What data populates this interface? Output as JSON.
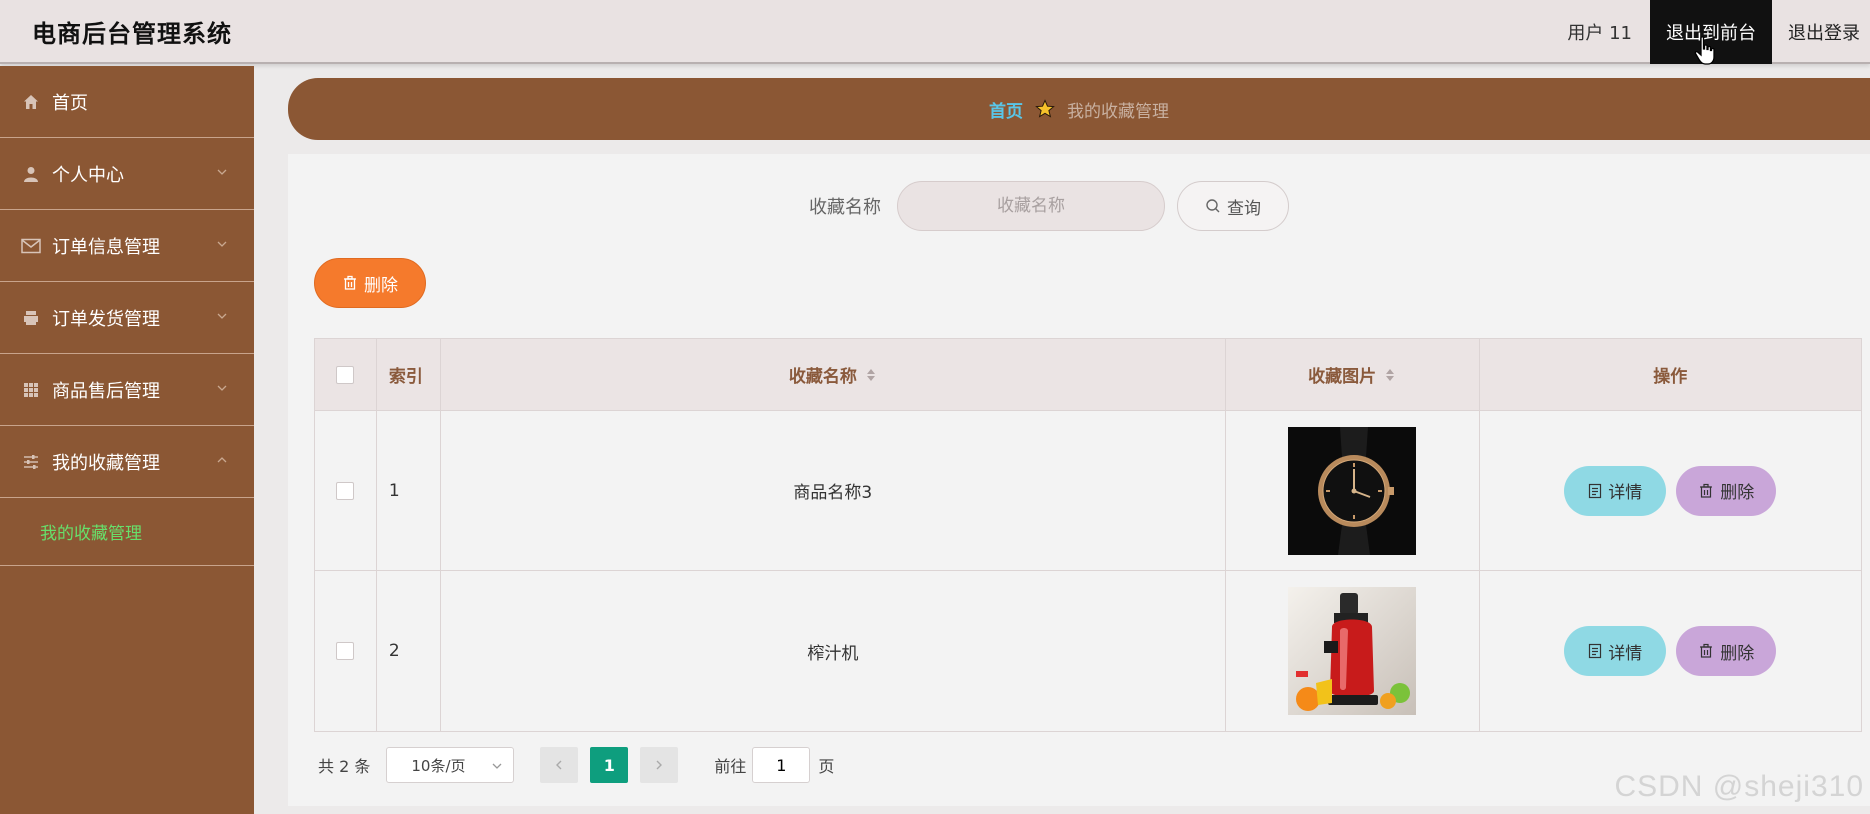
{
  "header": {
    "title": "电商后台管理系统",
    "user": "用户 11",
    "front_label": "退出到前台",
    "logout_label": "退出登录"
  },
  "sidebar": {
    "items": [
      {
        "label": "首页",
        "icon": "home-icon"
      },
      {
        "label": "个人中心",
        "icon": "user-icon"
      },
      {
        "label": "订单信息管理",
        "icon": "mail-icon"
      },
      {
        "label": "订单发货管理",
        "icon": "printer-icon"
      },
      {
        "label": "商品售后管理",
        "icon": "grid-icon"
      },
      {
        "label": "我的收藏管理",
        "icon": "sliders-icon"
      }
    ],
    "submenu_label": "我的收藏管理"
  },
  "breadcrumb": {
    "home": "首页",
    "current": "我的收藏管理"
  },
  "search": {
    "label": "收藏名称",
    "placeholder": "收藏名称",
    "query_label": "查询"
  },
  "toolbar": {
    "delete_label": "删除"
  },
  "table": {
    "headers": {
      "index": "索引",
      "name": "收藏名称",
      "image": "收藏图片",
      "action": "操作"
    },
    "rows": [
      {
        "index": "1",
        "name": "商品名称3",
        "image": "wristwatch",
        "detail": "详情",
        "delete": "删除"
      },
      {
        "index": "2",
        "name": "榨汁机",
        "image": "juicer",
        "detail": "详情",
        "delete": "删除"
      }
    ]
  },
  "pagination": {
    "total": "共 2 条",
    "page_size": "10条/页",
    "current_page": "1",
    "goto_label": "前往",
    "goto_value": "1",
    "page_unit": "页"
  },
  "watermark": "CSDN @sheji310",
  "colors": {
    "sidebar": "#8b5734",
    "accent_active": "#67e06b",
    "delete_button": "#f57a2c",
    "detail_button": "#8fd9e4",
    "row_delete_button": "#c9a6d9",
    "page_active": "#0e9e7e"
  }
}
